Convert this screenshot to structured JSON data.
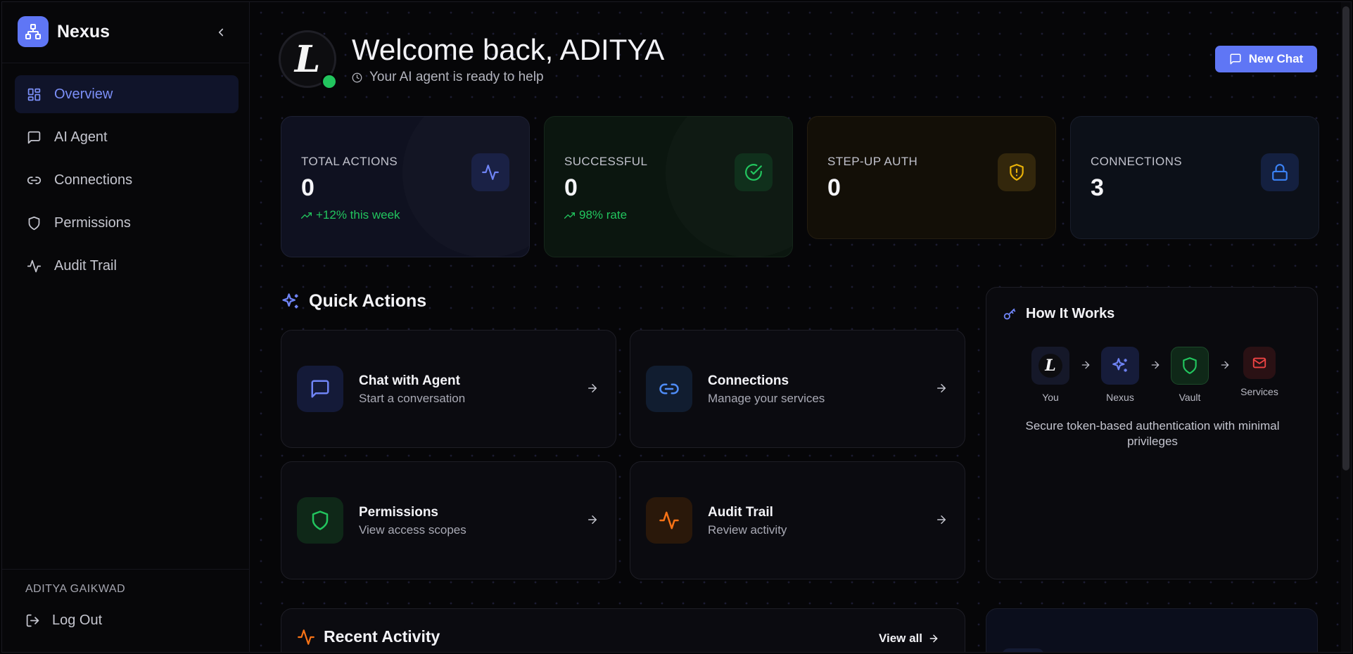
{
  "sidebar": {
    "brand": "Nexus",
    "items": [
      {
        "label": "Overview",
        "icon": "layout-grid-icon",
        "active": true
      },
      {
        "label": "AI Agent",
        "icon": "message-square-icon",
        "active": false
      },
      {
        "label": "Connections",
        "icon": "link-icon",
        "active": false
      },
      {
        "label": "Permissions",
        "icon": "shield-icon",
        "active": false
      },
      {
        "label": "Audit Trail",
        "icon": "activity-icon",
        "active": false
      }
    ],
    "user_name": "ADITYA GAIKWAD",
    "logout_label": "Log Out"
  },
  "header": {
    "avatar_letter": "L",
    "welcome": "Welcome back, ADITYA",
    "subtitle": "Your AI agent is ready to help",
    "new_chat_label": "New Chat"
  },
  "stats": [
    {
      "label": "TOTAL ACTIONS",
      "value": "0",
      "trend": "+12% this week",
      "icon": "activity-icon"
    },
    {
      "label": "SUCCESSFUL",
      "value": "0",
      "trend": "98% rate",
      "icon": "check-circle-icon"
    },
    {
      "label": "STEP-UP AUTH",
      "value": "0",
      "trend": "",
      "icon": "shield-alert-icon"
    },
    {
      "label": "CONNECTIONS",
      "value": "3",
      "trend": "",
      "icon": "lock-icon"
    }
  ],
  "quick_actions": {
    "heading": "Quick Actions",
    "items": [
      {
        "title": "Chat with Agent",
        "subtitle": "Start a conversation",
        "icon": "message-square-icon"
      },
      {
        "title": "Connections",
        "subtitle": "Manage your services",
        "icon": "link-icon"
      },
      {
        "title": "Permissions",
        "subtitle": "View access scopes",
        "icon": "shield-icon"
      },
      {
        "title": "Audit Trail",
        "subtitle": "Review activity",
        "icon": "activity-icon"
      }
    ]
  },
  "how_it_works": {
    "heading": "How It Works",
    "steps": [
      {
        "label": "You",
        "letter": "L"
      },
      {
        "label": "Nexus"
      },
      {
        "label": "Vault"
      },
      {
        "label": "Services"
      }
    ],
    "description": "Secure token-based authentication with minimal privileges"
  },
  "recent_activity": {
    "heading": "Recent Activity",
    "view_all_label": "View all"
  },
  "colors": {
    "accent": "#5f76f5",
    "success": "#22c55e",
    "warning": "#eab308",
    "danger": "#ef4444",
    "orange": "#f97316",
    "background": "#060608"
  }
}
